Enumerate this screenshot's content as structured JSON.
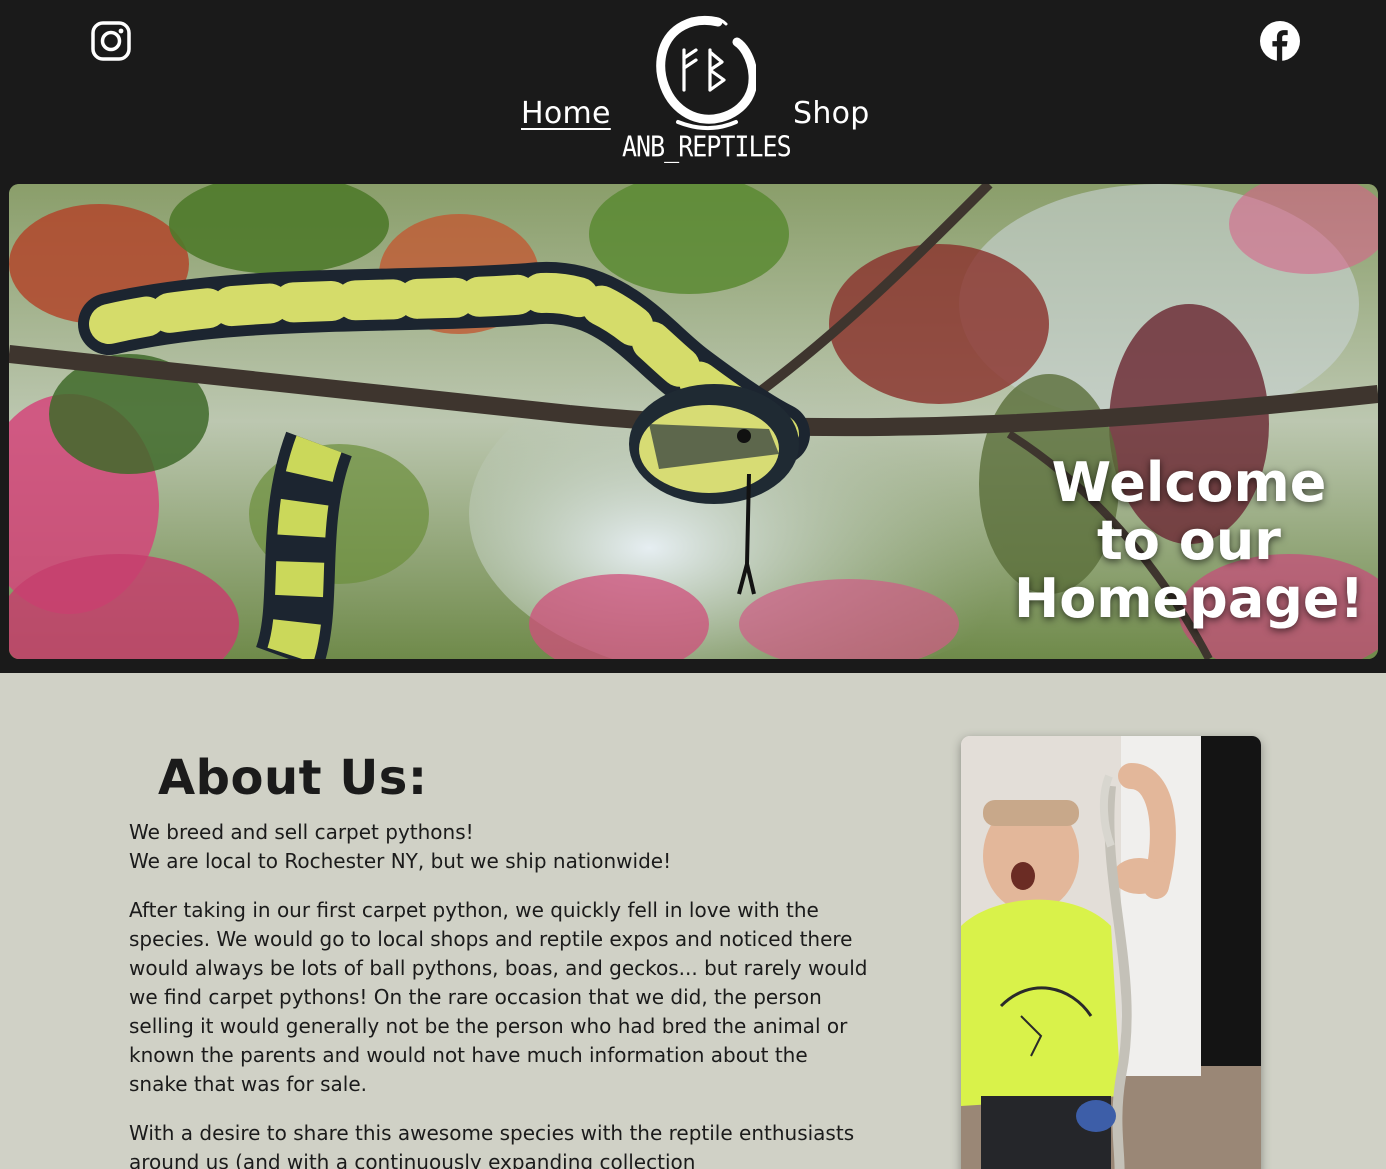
{
  "header": {
    "instagram_icon": "instagram-icon",
    "facebook_icon": "facebook-icon",
    "nav": {
      "home_label": "Home",
      "shop_label": "Shop"
    },
    "logo": {
      "monogram_icon": "fb-monogram-icon",
      "text": "ANB_REPTILES"
    }
  },
  "hero": {
    "title": "Welcome to our Homepage!"
  },
  "about": {
    "heading": "About Us:",
    "line1": "We breed and sell carpet pythons!",
    "line2": "We are local to Rochester NY, but we ship nationwide!",
    "paragraph2": "After taking in our first carpet python, we quickly fell in love with the species. We would go to local shops and reptile expos and noticed there would always be lots of ball pythons, boas, and geckos... but rarely would we find carpet pythons! On the rare occasion that we did, the person selling it would generally not be the person who had bred the animal or known the parents and would not have much information about the snake that was for sale.",
    "paragraph3": "With a desire to share this awesome species with the reptile enthusiasts around us (and with a continuously expanding collection"
  },
  "colors": {
    "header_bg": "#1a1a1a",
    "page_bg": "#d0d1c6",
    "text": "#1b1b1b",
    "header_text": "#ffffff"
  }
}
